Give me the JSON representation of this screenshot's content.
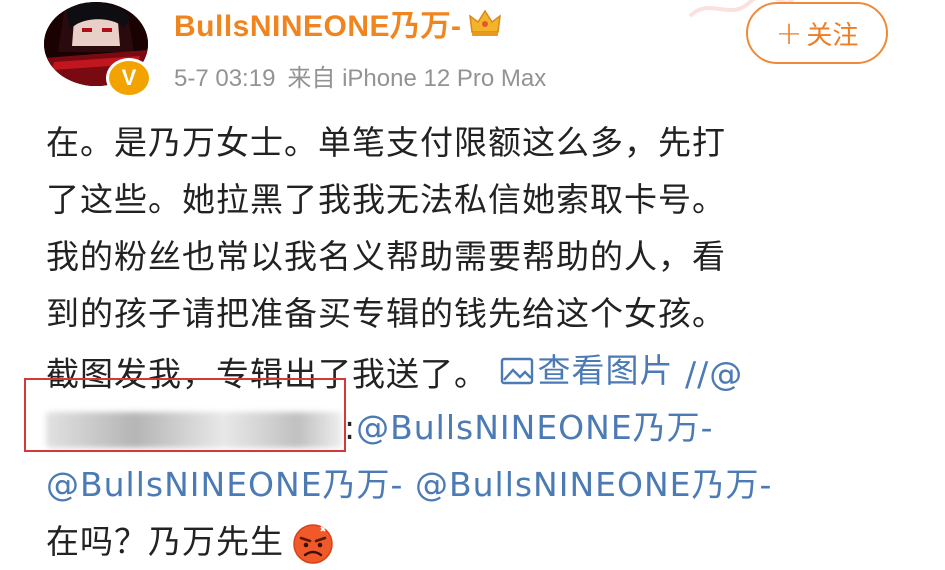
{
  "post": {
    "username": "BullsNINEONE乃万-",
    "badge_letter": "V",
    "date": "5-7 03:19",
    "source": "来自 iPhone 12 Pro Max",
    "follow_plus": "+",
    "follow_label": "关注"
  },
  "content": {
    "line1": "在。是乃万女士。单笔支付限额这么多，先打",
    "line2": "了这些。她拉黑了我我无法私信她索取卡号。",
    "line3": "我的粉丝也常以我名义帮助需要帮助的人，看",
    "line4": "到的孩子请把准备买专辑的钱先给这个女孩。",
    "line5_text": "截图发我，专辑出了我送了。 ",
    "view_pic_label": "查看图片",
    "line5_tail": " //@",
    "line6_colon": ":",
    "mention1": "@BullsNINEONE乃万-",
    "mention2": "@BullsNINEONE乃万-",
    "mention3": "@BullsNINEONE乃万-",
    "line8": "在吗？乃万先生"
  },
  "colors": {
    "username": "#f08520",
    "link": "#4b7ab5",
    "text": "#222222",
    "meta": "#939393",
    "follow": "#ef7d24",
    "highlight_box": "#d23a3a"
  },
  "icons": [
    "avatar-image",
    "verified-badge-icon",
    "crown-badge-icon",
    "image-icon",
    "angry-emoji-icon"
  ]
}
